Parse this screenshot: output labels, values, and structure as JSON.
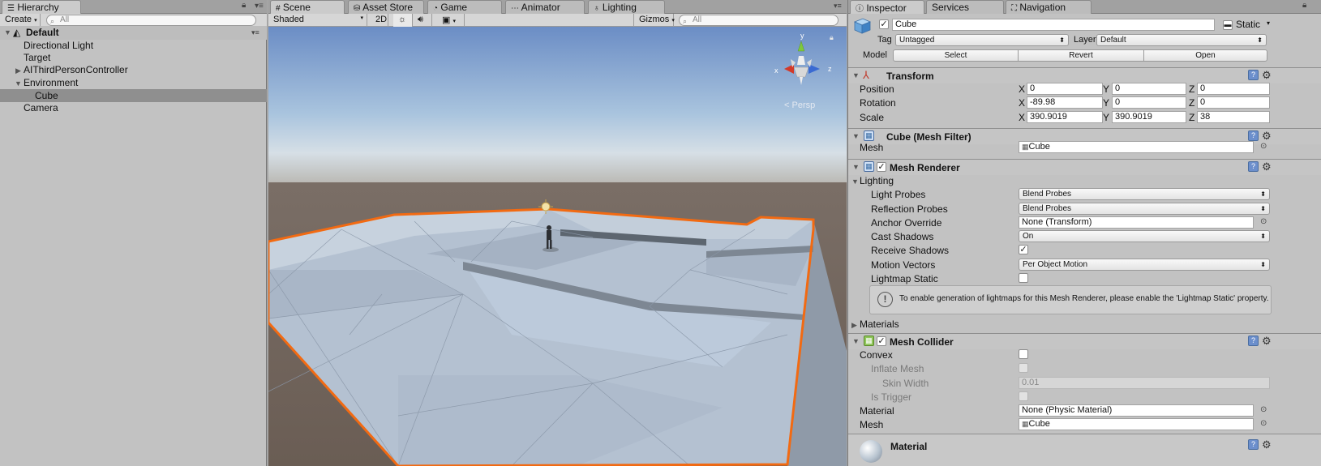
{
  "hierarchy": {
    "tab_label": "Hierarchy",
    "create_label": "Create",
    "search_placeholder": "All",
    "scene_name": "Default",
    "items": [
      {
        "label": "Directional Light"
      },
      {
        "label": "Target"
      },
      {
        "label": "AIThirdPersonController"
      },
      {
        "label": "Environment"
      },
      {
        "label": "Cube"
      },
      {
        "label": "Camera"
      }
    ]
  },
  "scene_view": {
    "tabs": [
      {
        "label": "Scene"
      },
      {
        "label": "Asset Store"
      },
      {
        "label": "Game"
      },
      {
        "label": "Animator"
      },
      {
        "label": "Lighting"
      }
    ],
    "shading_mode": "Shaded",
    "mode_2d": "2D",
    "gizmos_label": "Gizmos",
    "search_placeholder": "All",
    "projection_label": "Persp",
    "axis_labels": {
      "x": "x",
      "y": "y",
      "z": "z"
    },
    "colors": {
      "selection_outline": "#f26a12",
      "sky_top": "#6d8fc4",
      "ground": "#6b5e55",
      "mesh": "#b3c0d0"
    }
  },
  "inspector": {
    "tabs": [
      {
        "label": "Inspector"
      },
      {
        "label": "Services"
      },
      {
        "label": "Navigation"
      }
    ],
    "object": {
      "name": "Cube",
      "static_label": "Static",
      "tag_label": "Tag",
      "tag_value": "Untagged",
      "layer_label": "Layer",
      "layer_value": "Default",
      "model_label": "Model",
      "model_buttons": [
        "Select",
        "Revert",
        "Open"
      ]
    },
    "transform": {
      "title": "Transform",
      "position_label": "Position",
      "rotation_label": "Rotation",
      "scale_label": "Scale",
      "axis": [
        "X",
        "Y",
        "Z"
      ],
      "position": [
        "0",
        "0",
        "0"
      ],
      "rotation": [
        "-89.98",
        "0",
        "0"
      ],
      "scale": [
        "390.9019",
        "390.9019",
        "38"
      ]
    },
    "mesh_filter": {
      "title": "Cube (Mesh Filter)",
      "mesh_label": "Mesh",
      "mesh_value": "Cube"
    },
    "mesh_renderer": {
      "title": "Mesh Renderer",
      "lighting_label": "Lighting",
      "light_probes_label": "Light Probes",
      "light_probes_value": "Blend Probes",
      "reflection_probes_label": "Reflection Probes",
      "reflection_probes_value": "Blend Probes",
      "anchor_override_label": "Anchor Override",
      "anchor_override_value": "None (Transform)",
      "cast_shadows_label": "Cast Shadows",
      "cast_shadows_value": "On",
      "receive_shadows_label": "Receive Shadows",
      "receive_shadows_checked": true,
      "motion_vectors_label": "Motion Vectors",
      "motion_vectors_value": "Per Object Motion",
      "lightmap_static_label": "Lightmap Static",
      "lightmap_static_checked": false,
      "info_message": "To enable generation of lightmaps for this Mesh Renderer, please enable the 'Lightmap Static' property.",
      "materials_label": "Materials"
    },
    "mesh_collider": {
      "title": "Mesh Collider",
      "convex_label": "Convex",
      "inflate_mesh_label": "Inflate Mesh",
      "skin_width_label": "Skin Width",
      "skin_width_value": "0.01",
      "is_trigger_label": "Is Trigger",
      "material_label": "Material",
      "material_value": "None (Physic Material)",
      "mesh_label": "Mesh",
      "mesh_value": "Cube"
    },
    "material_preview": {
      "title": "Material"
    }
  }
}
